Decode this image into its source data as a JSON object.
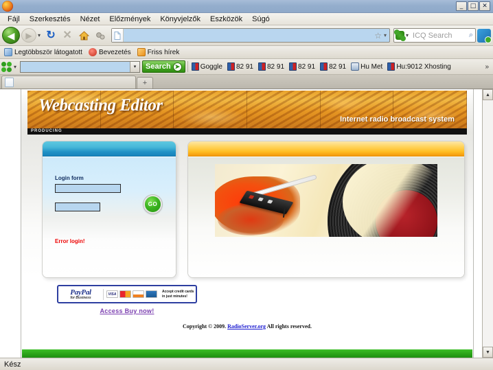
{
  "window": {
    "title": "",
    "minimize": "_",
    "maximize": "□",
    "close": "✕"
  },
  "menu": {
    "items": [
      "Fájl",
      "Szerkesztés",
      "Nézet",
      "Előzmények",
      "Könyvjelzők",
      "Eszközök",
      "Súgó"
    ]
  },
  "navbar": {
    "back_icon": "◀",
    "forward_icon": "▶",
    "dropdown_icon": "▾",
    "reload_icon": "↻",
    "stop_icon": "✕",
    "home_icon": "⌂",
    "feed_icon": "◉",
    "url_value": "",
    "star_icon": "☆",
    "star_caret": "▾",
    "search_placeholder": "ICQ Search",
    "search_magnifier": "⌕"
  },
  "bookmarks_toolbar": {
    "items": [
      {
        "label": "Legtöbbször látogatott",
        "icon": "folder-icon"
      },
      {
        "label": "Bevezetés",
        "icon": "firefox-icon"
      },
      {
        "label": "Friss hírek",
        "icon": "rss-icon"
      }
    ]
  },
  "icq_toolbar": {
    "input_value": "",
    "input_caret": "▾",
    "search_label": "Search",
    "search_go": "➤",
    "items": [
      {
        "label": "Goggle",
        "icon": "bookmark-icon"
      },
      {
        "label": "82 91",
        "icon": "bookmark-icon"
      },
      {
        "label": "82 91",
        "icon": "bookmark-icon"
      },
      {
        "label": "82 91",
        "icon": "bookmark-icon"
      },
      {
        "label": "82 91",
        "icon": "bookmark-icon"
      },
      {
        "label": "Hu Met",
        "icon": "shield-icon"
      },
      {
        "label": "Hu:9012 Xhosting",
        "icon": "bookmark-icon"
      }
    ],
    "overflow_icon": "»"
  },
  "tabbar": {
    "tab_title": "",
    "newtab_icon": "+"
  },
  "page": {
    "banner": {
      "title": "Webcasting Editor",
      "subtitle": "Internet radio broadcast system",
      "strip_label": "PRODUCING"
    },
    "login_panel": {
      "form_label": "Login form",
      "username_value": "",
      "password_value": "",
      "submit_label": "GO",
      "error_text": "Error login!"
    },
    "media_panel": {
      "image_alt": "turntable-record-photo"
    },
    "paypal": {
      "logo_main": "PayPal",
      "logo_sub": "for Business",
      "visa_label": "VISA",
      "discover_label": "DISC•VER",
      "tagline_line1": "Accept credit cards",
      "tagline_line2": "in just minutes!",
      "buy_link": "Access Buy now!"
    },
    "footer": {
      "copyright_prefix": "Copyright © 2009. ",
      "site_link": "RadioServer.org",
      "copyright_suffix": " All rights reserved."
    }
  },
  "scrollbar": {
    "up_icon": "▲",
    "down_icon": "▼"
  },
  "statusbar": {
    "text": "Kész"
  },
  "colors": {
    "accent_blue": "#1e8fc4",
    "accent_orange": "#ffbe24",
    "error_red": "#ee0000",
    "go_green": "#3cb521",
    "link_purple": "#7b3fb0"
  }
}
